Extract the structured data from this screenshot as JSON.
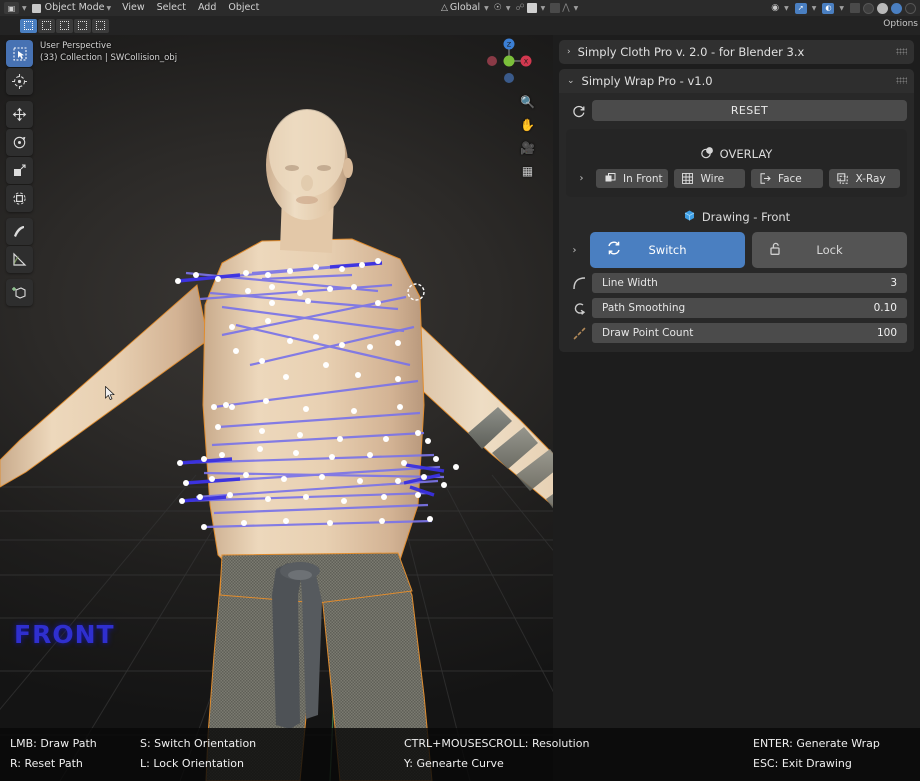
{
  "window": {
    "editor_type_icon": "editor-type-icon",
    "mode": "Object Mode",
    "menus": [
      "View",
      "Select",
      "Add",
      "Object"
    ],
    "transform_orientation": "Global",
    "options_label": "Options",
    "snap_icon": "magnet-icon",
    "proportional_icon": "proportional-edit-icon",
    "pivot_icon": "pivot-point-icon"
  },
  "viewport": {
    "perspective": "User Perspective",
    "collection_info": "(33) Collection | SWCollision_obj",
    "orientation_label": "FRONT",
    "orientation_color": "#2f2fcf",
    "gizmo": {
      "axes": [
        {
          "name": "Z",
          "color": "#3b7fd4"
        },
        {
          "name": "X",
          "color": "#d2384f"
        },
        {
          "name": "Y",
          "color": "#7bbf3a"
        }
      ]
    },
    "nav_buttons": [
      "zoom-icon",
      "hand-icon",
      "camera-icon",
      "grid-icon"
    ],
    "toolbar": [
      {
        "name": "tweak-select-box-tool",
        "glyph": "◱",
        "active": true
      },
      {
        "name": "cursor-tool",
        "glyph": "⊕",
        "active": false
      },
      {
        "name": "move-tool",
        "glyph": "✛",
        "active": false
      },
      {
        "name": "rotate-tool",
        "glyph": "◌",
        "active": false
      },
      {
        "name": "scale-tool",
        "glyph": "◰",
        "active": false
      },
      {
        "name": "transform-tool",
        "glyph": "◎",
        "active": false
      },
      {
        "name": "annotate-tool",
        "glyph": "✎",
        "active": false
      },
      {
        "name": "measure-tool",
        "glyph": "◢",
        "active": false
      },
      {
        "name": "add-cube-tool",
        "glyph": "⬛",
        "active": false
      }
    ]
  },
  "status_bar": {
    "col1": [
      "LMB: Draw Path",
      "R: Reset Path"
    ],
    "col2": [
      "S: Switch Orientation",
      "L: Lock Orientation"
    ],
    "col3": [
      "CTRL+MOUSESCROLL: Resolution",
      "Y: Genearte Curve"
    ],
    "col4": [
      "ENTER: Generate Wrap",
      "ESC: Exit Drawing"
    ]
  },
  "panel": {
    "cloth_pro": {
      "title": "Simply Cloth Pro v. 2.0 - for Blender 3.x",
      "expanded": false,
      "arrow": "›"
    },
    "wrap_pro": {
      "title": "Simply Wrap Pro - v1.0",
      "expanded": true,
      "arrow": "⌄",
      "reset": {
        "label": "RESET",
        "icon": "refresh-icon"
      },
      "overlay": {
        "title": "OVERLAY",
        "icon": "overlay-icon",
        "expand_arrow": "›",
        "toggles": [
          {
            "label": "In Front",
            "icon": "in-front-icon"
          },
          {
            "label": "Wire",
            "icon": "wire-icon"
          },
          {
            "label": "Face",
            "icon": "face-icon"
          },
          {
            "label": "X-Ray",
            "icon": "xray-icon"
          }
        ]
      },
      "drawing": {
        "title": "Drawing - Front",
        "icon": "cube-blue-icon",
        "expand_arrow": "›",
        "switch": {
          "label": "Switch",
          "icon": "switch-icon",
          "active": true,
          "color": "#4a7fc1"
        },
        "lock": {
          "label": "Lock",
          "icon": "unlock-icon",
          "active": false,
          "color": "#545454"
        },
        "sliders": [
          {
            "label": "Line Width",
            "value": "3",
            "icon": "curve-icon"
          },
          {
            "label": "Path Smoothing",
            "value": "0.10",
            "icon": "smooth-icon"
          },
          {
            "label": "Draw Point Count",
            "value": "100",
            "icon": "dots-icon"
          }
        ]
      }
    }
  }
}
